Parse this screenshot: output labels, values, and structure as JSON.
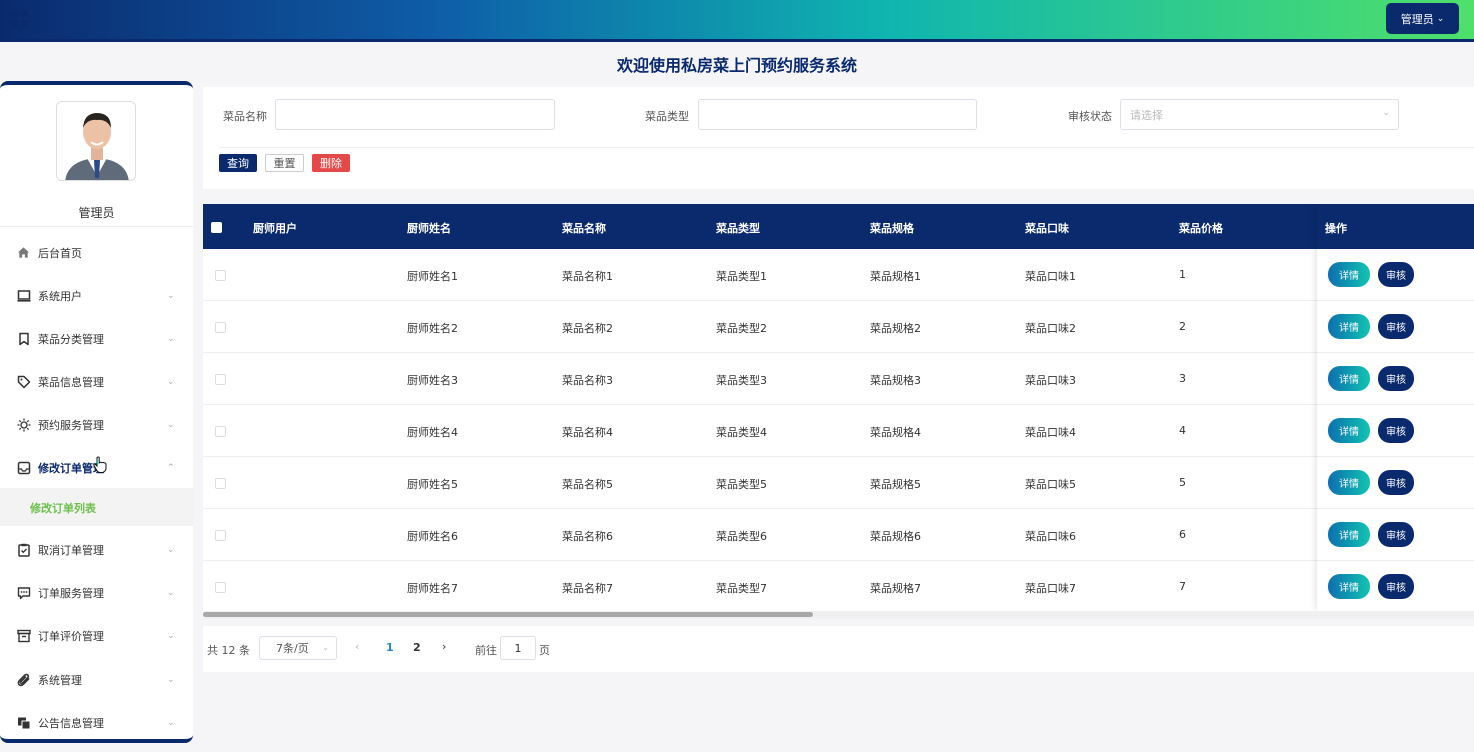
{
  "header": {
    "user_menu": "管理员",
    "welcome": "欢迎使用私房菜上门预约服务系统"
  },
  "sidebar": {
    "role": "管理员",
    "items": [
      {
        "label": "后台首页",
        "icon": "home-icon"
      },
      {
        "label": "系统用户",
        "icon": "monitor-icon"
      },
      {
        "label": "菜品分类管理",
        "icon": "bookmark-icon"
      },
      {
        "label": "菜品信息管理",
        "icon": "tag-icon"
      },
      {
        "label": "预约服务管理",
        "icon": "sun-icon"
      },
      {
        "label": "修改订单管理",
        "icon": "inbox-icon"
      },
      {
        "label": "取消订单管理",
        "icon": "clipboard-check-icon"
      },
      {
        "label": "订单服务管理",
        "icon": "chat-icon"
      },
      {
        "label": "订单评价管理",
        "icon": "archive-icon"
      },
      {
        "label": "系统管理",
        "icon": "paperclip-icon"
      },
      {
        "label": "公告信息管理",
        "icon": "copy-icon"
      }
    ],
    "sub_item": "修改订单列表"
  },
  "search": {
    "dish_name_label": "菜品名称",
    "dish_name_value": "",
    "dish_type_label": "菜品类型",
    "dish_type_value": "",
    "status_label": "审核状态",
    "status_placeholder": "请选择",
    "query_btn": "查询",
    "reset_btn": "重置",
    "delete_btn": "删除"
  },
  "table": {
    "headers": [
      "厨师用户",
      "厨师姓名",
      "菜品名称",
      "菜品类型",
      "菜品规格",
      "菜品口味",
      "菜品价格"
    ],
    "op_header": "操作",
    "detail_btn": "详情",
    "review_btn": "审核",
    "rows": [
      [
        "",
        "厨师姓名1",
        "菜品名称1",
        "菜品类型1",
        "菜品规格1",
        "菜品口味1",
        "1"
      ],
      [
        "",
        "厨师姓名2",
        "菜品名称2",
        "菜品类型2",
        "菜品规格2",
        "菜品口味2",
        "2"
      ],
      [
        "",
        "厨师姓名3",
        "菜品名称3",
        "菜品类型3",
        "菜品规格3",
        "菜品口味3",
        "3"
      ],
      [
        "",
        "厨师姓名4",
        "菜品名称4",
        "菜品类型4",
        "菜品规格4",
        "菜品口味4",
        "4"
      ],
      [
        "",
        "厨师姓名5",
        "菜品名称5",
        "菜品类型5",
        "菜品规格5",
        "菜品口味5",
        "5"
      ],
      [
        "",
        "厨师姓名6",
        "菜品名称6",
        "菜品类型6",
        "菜品规格6",
        "菜品口味6",
        "6"
      ],
      [
        "",
        "厨师姓名7",
        "菜品名称7",
        "菜品类型7",
        "菜品规格7",
        "菜品口味7",
        "7"
      ]
    ]
  },
  "pagination": {
    "total": "共 12 条",
    "page_size": "7条/页",
    "pages": [
      "1",
      "2"
    ],
    "current_page": "1",
    "goto_label": "前往",
    "goto_value": "1",
    "page_suffix": "页"
  },
  "colors": {
    "primary": "#0b2a6e",
    "accent_green": "#6cc04a",
    "danger": "#e54848"
  }
}
